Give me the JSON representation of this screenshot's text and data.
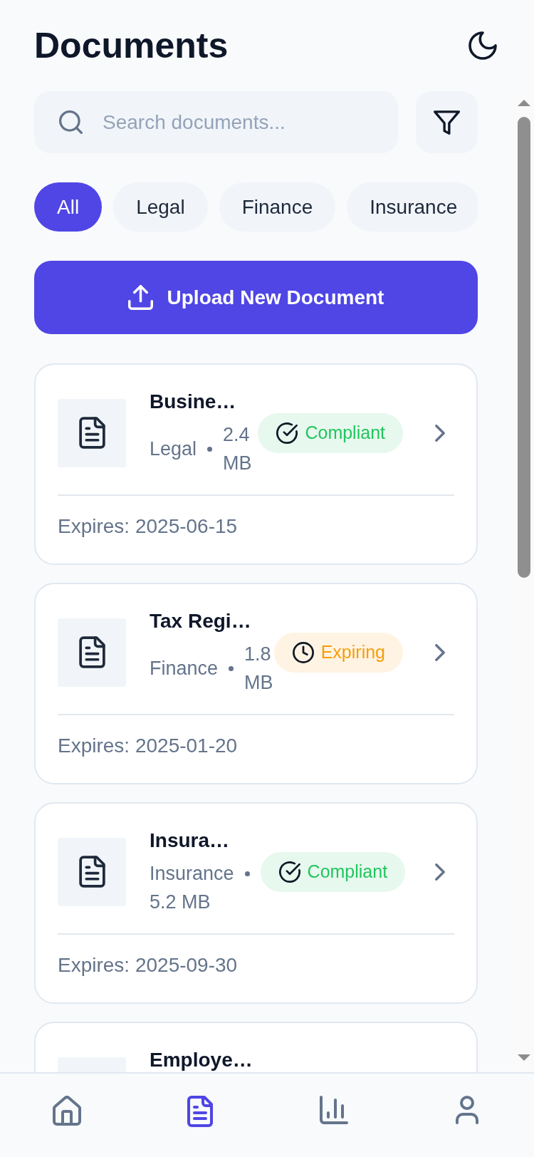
{
  "header": {
    "title": "Documents"
  },
  "search": {
    "placeholder": "Search documents..."
  },
  "filters": [
    {
      "label": "All",
      "selected": true
    },
    {
      "label": "Legal",
      "selected": false
    },
    {
      "label": "Finance",
      "selected": false
    },
    {
      "label": "Insurance",
      "selected": false
    }
  ],
  "upload_button": {
    "label": "Upload New Document"
  },
  "documents": [
    {
      "title": "Busine…",
      "category": "Legal",
      "size": "2.4 MB",
      "kind": "compliant",
      "status_label": "Compliant",
      "expires": "Expires: 2025-06-15"
    },
    {
      "title": "Tax Regi…",
      "category": "Finance",
      "size": "1.8 MB",
      "kind": "expiring",
      "status_label": "Expiring",
      "expires": "Expires: 2025-01-20"
    },
    {
      "title": "Insura…",
      "category": "Insurance",
      "size": "5.2 MB",
      "kind": "compliant",
      "status_label": "Compliant",
      "expires": "Expires: 2025-09-30"
    },
    {
      "title": "Employe…"
    }
  ],
  "nav": [
    {
      "kind": "home",
      "selected": false
    },
    {
      "kind": "document",
      "selected": true
    },
    {
      "kind": "chart",
      "selected": false
    },
    {
      "kind": "user",
      "selected": false
    }
  ]
}
